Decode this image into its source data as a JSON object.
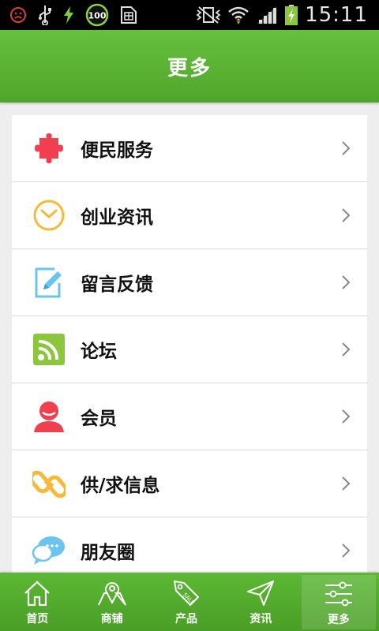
{
  "status_bar": {
    "time": "15:11",
    "battery_badge": "100",
    "icons": [
      "sad-face-icon",
      "usb-icon",
      "charging-bolt-icon",
      "battery-100-badge-icon",
      "sim-card-icon",
      "mute-vibrate-icon",
      "wifi-icon",
      "signal-icon",
      "battery-icon"
    ]
  },
  "header": {
    "title": "更多"
  },
  "menu": {
    "items": [
      {
        "label": "便民服务",
        "icon": "puzzle-icon",
        "color": "#f0404f"
      },
      {
        "label": "创业资讯",
        "icon": "clock-icon",
        "color": "#f7b938"
      },
      {
        "label": "留言反馈",
        "icon": "edit-note-icon",
        "color": "#69c4ef"
      },
      {
        "label": "论坛",
        "icon": "rss-icon",
        "color": "#8cc63f"
      },
      {
        "label": "会员",
        "icon": "user-icon",
        "color": "#f0404f"
      },
      {
        "label": "供/求信息",
        "icon": "chain-link-icon",
        "color": "#f7b938"
      },
      {
        "label": "朋友圈",
        "icon": "chat-bubble-icon",
        "color": "#69c4ef"
      }
    ]
  },
  "bottom_nav": {
    "items": [
      {
        "label": "首页",
        "icon": "home-icon"
      },
      {
        "label": "商铺",
        "icon": "map-pin-icon"
      },
      {
        "label": "产品",
        "icon": "sale-tag-icon"
      },
      {
        "label": "资讯",
        "icon": "paper-plane-icon"
      },
      {
        "label": "更多",
        "icon": "sliders-icon",
        "active": true
      }
    ]
  },
  "colors": {
    "primary_green": "#5cb834",
    "header_green": "#5bb535",
    "background": "#eeeeee"
  }
}
